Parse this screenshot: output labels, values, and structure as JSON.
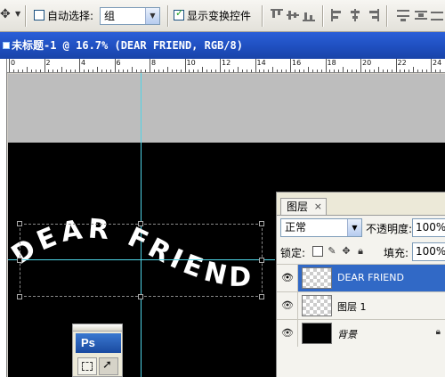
{
  "options_bar": {
    "tool_icon": "move-icon",
    "auto_select_label": "自动选择:",
    "auto_select_checked": false,
    "auto_select_value": "组",
    "show_transform_label": "显示变换控件",
    "show_transform_checked": true
  },
  "document": {
    "title": "未标题-1 @ 16.7% (DEAR FRIEND, RGB/8)"
  },
  "ruler": {
    "labels": [
      "0",
      "2",
      "4",
      "6",
      "8",
      "10",
      "12",
      "14",
      "16",
      "18",
      "20",
      "22",
      "24"
    ]
  },
  "canvas": {
    "gray_color": "#bdbdbd",
    "black_color": "#000000",
    "guide_color": "#4fd4e6",
    "warped_text": "DEAR FRIEND"
  },
  "toolbox": {
    "logo": "Ps"
  },
  "layers_panel": {
    "tab_label": "图层",
    "close_glyph": "×",
    "blend_mode": "正常",
    "opacity_label": "不透明度:",
    "opacity_value": "100%",
    "lock_label": "锁定:",
    "fill_label": "填充:",
    "fill_value": "100%",
    "selected_color": "#3169c6",
    "layers": [
      {
        "name": "DEAR FRIEND",
        "selected": true
      },
      {
        "name": "图层 1",
        "selected": false
      },
      {
        "name": "背景",
        "selected": false,
        "locked": true
      }
    ]
  }
}
